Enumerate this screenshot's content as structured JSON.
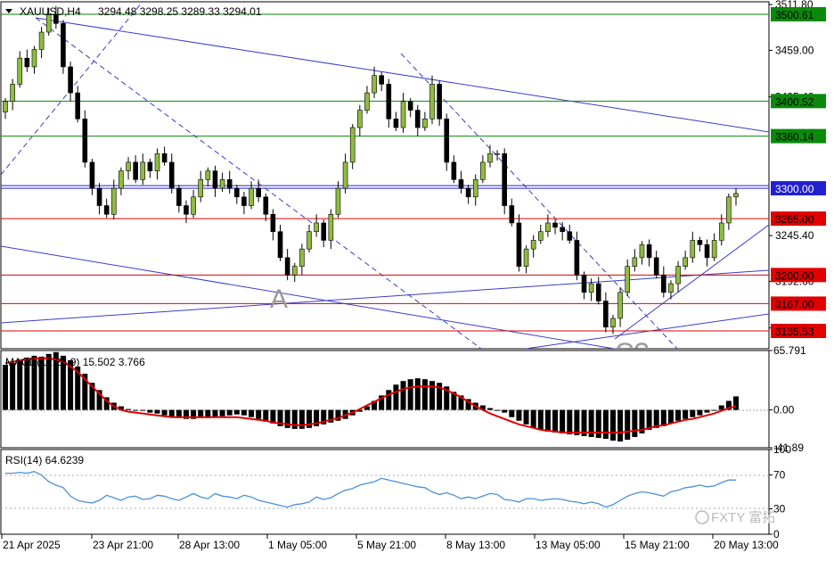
{
  "header": {
    "symbol": "XAUUSD,H4",
    "ohlc": "3294.48 3298.25 3289.33 3294.01"
  },
  "colors": {
    "bull": "#8fbc3f",
    "bear": "#000000",
    "trendline": "#3c3cc8",
    "support": "#e00000",
    "resistance": "#0a8a0a",
    "pivot": "#2020d0",
    "macd_signal": "#e00000",
    "rsi": "#4a90d9"
  },
  "annotations": {
    "wave_a": "A",
    "wave_c": "C?"
  },
  "watermark": "FXTY 富拓",
  "chart_data": [
    {
      "type": "candlestick",
      "title": "XAUUSD,H4",
      "ylim": [
        3115,
        3515
      ],
      "y_ticks": [
        3511.8,
        3459.0,
        3405.4,
        3245.4,
        3192.6,
        3139.0
      ],
      "x_ticks": [
        "21 Apr 2025",
        "23 Apr 21:00",
        "28 Apr 13:00",
        "1 May 05:00",
        "5 May 21:00",
        "8 May 13:00",
        "13 May 05:00",
        "15 May 21:00",
        "20 May 13:00"
      ],
      "closes": [
        3400,
        3420,
        3450,
        3440,
        3460,
        3480,
        3500,
        3490,
        3440,
        3410,
        3380,
        3330,
        3300,
        3280,
        3270,
        3300,
        3320,
        3330,
        3310,
        3330,
        3320,
        3340,
        3330,
        3300,
        3280,
        3270,
        3290,
        3310,
        3320,
        3300,
        3310,
        3300,
        3290,
        3280,
        3300,
        3290,
        3270,
        3250,
        3220,
        3200,
        3210,
        3230,
        3250,
        3260,
        3240,
        3270,
        3300,
        3330,
        3370,
        3390,
        3410,
        3430,
        3420,
        3380,
        3370,
        3400,
        3390,
        3370,
        3380,
        3420,
        3380,
        3330,
        3310,
        3300,
        3290,
        3310,
        3330,
        3340,
        3340,
        3280,
        3260,
        3210,
        3230,
        3240,
        3250,
        3260,
        3255,
        3250,
        3240,
        3200,
        3180,
        3190,
        3170,
        3140,
        3150,
        3180,
        3210,
        3220,
        3235,
        3220,
        3200,
        3180,
        3190,
        3210,
        3220,
        3240,
        3235,
        3220,
        3240,
        3260,
        3290,
        3294
      ],
      "price_levels": [
        {
          "label": "3500.61",
          "value": 3500.61,
          "color": "#0a8a0a",
          "kind": "resistance"
        },
        {
          "label": "3400.52",
          "value": 3400.52,
          "color": "#0a8a0a",
          "kind": "resistance"
        },
        {
          "label": "3360.14",
          "value": 3360.14,
          "color": "#0a8a0a",
          "kind": "resistance"
        },
        {
          "label": "3300.00",
          "value": 3300.0,
          "color": "#2020d0",
          "kind": "pivot"
        },
        {
          "label": "3265.00",
          "value": 3265.0,
          "color": "#e00000",
          "kind": "support"
        },
        {
          "label": "3200.00",
          "value": 3200.0,
          "color": "#e00000",
          "kind": "support"
        },
        {
          "label": "3167.00",
          "value": 3167.0,
          "color": "#e00000",
          "kind": "support"
        },
        {
          "label": "3135.53",
          "value": 3135.53,
          "color": "#e00000",
          "kind": "support"
        }
      ]
    },
    {
      "type": "bar",
      "title": "MACD(12,26,9) 15.502 3.766",
      "indicator": "MACD(12,26,9)",
      "last_macd": 15.502,
      "last_signal": 3.766,
      "ylim": [
        -41.89,
        65.791
      ],
      "y_ticks": [
        "65.791",
        "0.00",
        "-41.89"
      ],
      "histogram": [
        50,
        52,
        55,
        58,
        60,
        59,
        62,
        64,
        60,
        55,
        48,
        40,
        30,
        22,
        14,
        8,
        4,
        1,
        0,
        -1,
        -3,
        -4,
        -6,
        -8,
        -9,
        -10,
        -10,
        -9,
        -9,
        -8,
        -7,
        -6,
        -5,
        -6,
        -8,
        -10,
        -13,
        -15,
        -18,
        -20,
        -21,
        -21,
        -20,
        -18,
        -16,
        -14,
        -12,
        -10,
        -6,
        -2,
        4,
        10,
        16,
        22,
        28,
        32,
        34,
        35,
        34,
        32,
        30,
        26,
        20,
        16,
        12,
        8,
        5,
        2,
        0,
        -3,
        -8,
        -12,
        -16,
        -20,
        -22,
        -24,
        -25,
        -26,
        -27,
        -28,
        -29,
        -30,
        -31,
        -32,
        -34,
        -35,
        -33,
        -30,
        -26,
        -22,
        -20,
        -18,
        -15,
        -12,
        -10,
        -8,
        -6,
        -3,
        0,
        5,
        10,
        15
      ],
      "signal": [
        52,
        53,
        55,
        56,
        57,
        57,
        57,
        56,
        53,
        48,
        42,
        34,
        26,
        18,
        10,
        4,
        0,
        -2,
        -3,
        -4,
        -5,
        -6,
        -7,
        -8,
        -8,
        -8,
        -8,
        -8,
        -8,
        -8,
        -8,
        -8,
        -8,
        -9,
        -10,
        -11,
        -12,
        -14,
        -15,
        -16,
        -17,
        -17,
        -16,
        -15,
        -13,
        -11,
        -9,
        -6,
        -3,
        1,
        5,
        9,
        13,
        17,
        20,
        23,
        25,
        26,
        26,
        26,
        25,
        22,
        18,
        14,
        9,
        4,
        0,
        -4,
        -7,
        -10,
        -13,
        -16,
        -18,
        -20,
        -22,
        -23,
        -24,
        -25,
        -25,
        -25,
        -25,
        -25,
        -25,
        -25,
        -25,
        -25,
        -24,
        -23,
        -22,
        -20,
        -18,
        -17,
        -15,
        -13,
        -11,
        -10,
        -8,
        -6,
        -4,
        -1,
        2,
        4
      ]
    },
    {
      "type": "line",
      "title": "RSI(14) 64.6239",
      "indicator": "RSI(14)",
      "last_value": 64.6239,
      "ylim": [
        0,
        100
      ],
      "y_ticks": [
        "100",
        "70",
        "30",
        "0"
      ],
      "values": [
        72,
        72,
        73,
        72,
        74,
        70,
        62,
        58,
        55,
        45,
        40,
        38,
        37,
        40,
        46,
        43,
        40,
        44,
        45,
        41,
        42,
        46,
        45,
        42,
        40,
        44,
        48,
        44,
        42,
        48,
        45,
        44,
        42,
        46,
        44,
        40,
        38,
        36,
        34,
        32,
        35,
        36,
        38,
        44,
        41,
        43,
        48,
        52,
        54,
        58,
        60,
        62,
        66,
        64,
        62,
        60,
        58,
        56,
        55,
        50,
        47,
        49,
        46,
        42,
        44,
        42,
        45,
        48,
        47,
        41,
        40,
        38,
        42,
        42,
        40,
        41,
        42,
        41,
        39,
        38,
        36,
        38,
        36,
        32,
        35,
        40,
        45,
        48,
        50,
        49,
        47,
        45,
        50,
        52,
        55,
        56,
        58,
        56,
        57,
        61,
        64,
        64
      ]
    }
  ]
}
